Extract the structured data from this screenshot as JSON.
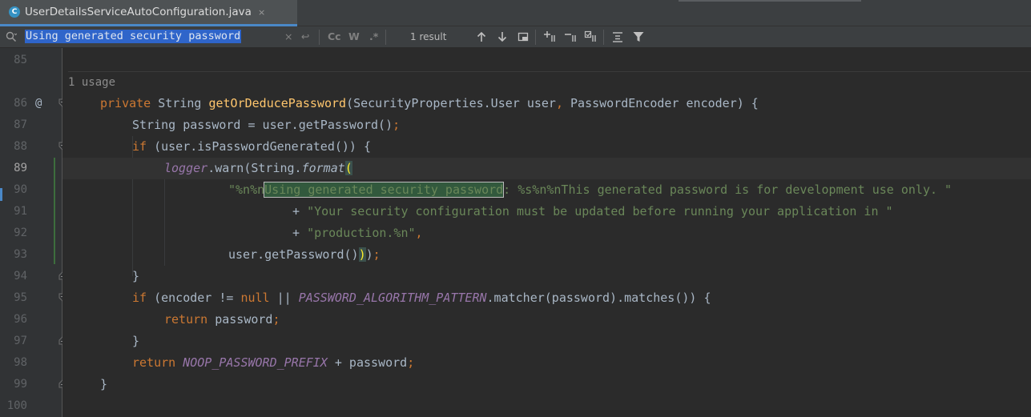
{
  "tab": {
    "filename": "UserDetailsServiceAutoConfiguration.java",
    "icon_letter": "C",
    "close_icon": "×"
  },
  "search": {
    "query": "Using generated security password",
    "clear_icon": "×",
    "regex_undo_icon": "↩",
    "match_case_label": "Cc",
    "words_label": "W",
    "regex_label": ".*",
    "results": "1 result"
  },
  "editor": {
    "usage_hint": "1 usage",
    "line_numbers": [
      "85",
      "86",
      "87",
      "88",
      "89",
      "90",
      "91",
      "92",
      "93",
      "94",
      "95",
      "96",
      "97",
      "98",
      "99",
      "100"
    ],
    "at_marker": "@",
    "lines": {
      "l86": {
        "kw_private": "private ",
        "type": "String ",
        "method": "getOrDeducePassword",
        "params_a": "(SecurityProperties.User user",
        "comma": ", ",
        "params_b": "PasswordEncoder encoder) {"
      },
      "l87": {
        "text": "String password = user.getPassword()",
        "semi": ";"
      },
      "l88": {
        "kw_if": "if ",
        "text": "(user.isPasswordGenerated()) {"
      },
      "l89": {
        "logger": "logger",
        "warn": ".warn(String.",
        "format": "format",
        "paren": "("
      },
      "l90": {
        "str_pre": "\"%n%n",
        "str_match": "Using generated security password",
        "str_post": ": %s%n%nThis generated password is for development use only. \""
      },
      "l91": {
        "plus": "+ ",
        "str": "\"Your security configuration must be updated before running your application in \""
      },
      "l92": {
        "plus": "+ ",
        "str": "\"production.%n\"",
        "comma": ","
      },
      "l93": {
        "text": "user.getPassword()",
        "paren_close": ")",
        "paren_end": ")",
        "semi": ";"
      },
      "l94": {
        "text": "}"
      },
      "l95": {
        "kw_if": "if ",
        "text_a": "(encoder != ",
        "kw_null": "null",
        "text_b": " || ",
        "field": "PASSWORD_ALGORITHM_PATTERN",
        "text_c": ".matcher(password).matches()) {"
      },
      "l96": {
        "kw_return": "return ",
        "text": "password",
        "semi": ";"
      },
      "l97": {
        "text": "}"
      },
      "l98": {
        "kw_return": "return ",
        "field": "NOOP_PASSWORD_PREFIX",
        "text": " + password",
        "semi": ";"
      },
      "l99": {
        "text": "}"
      }
    }
  },
  "colors": {
    "background": "#2b2b2b",
    "keyword": "#cc7832",
    "method_decl": "#ffc66d",
    "string": "#6a8759",
    "static_field": "#9876aa",
    "selection": "#2f65ca"
  }
}
